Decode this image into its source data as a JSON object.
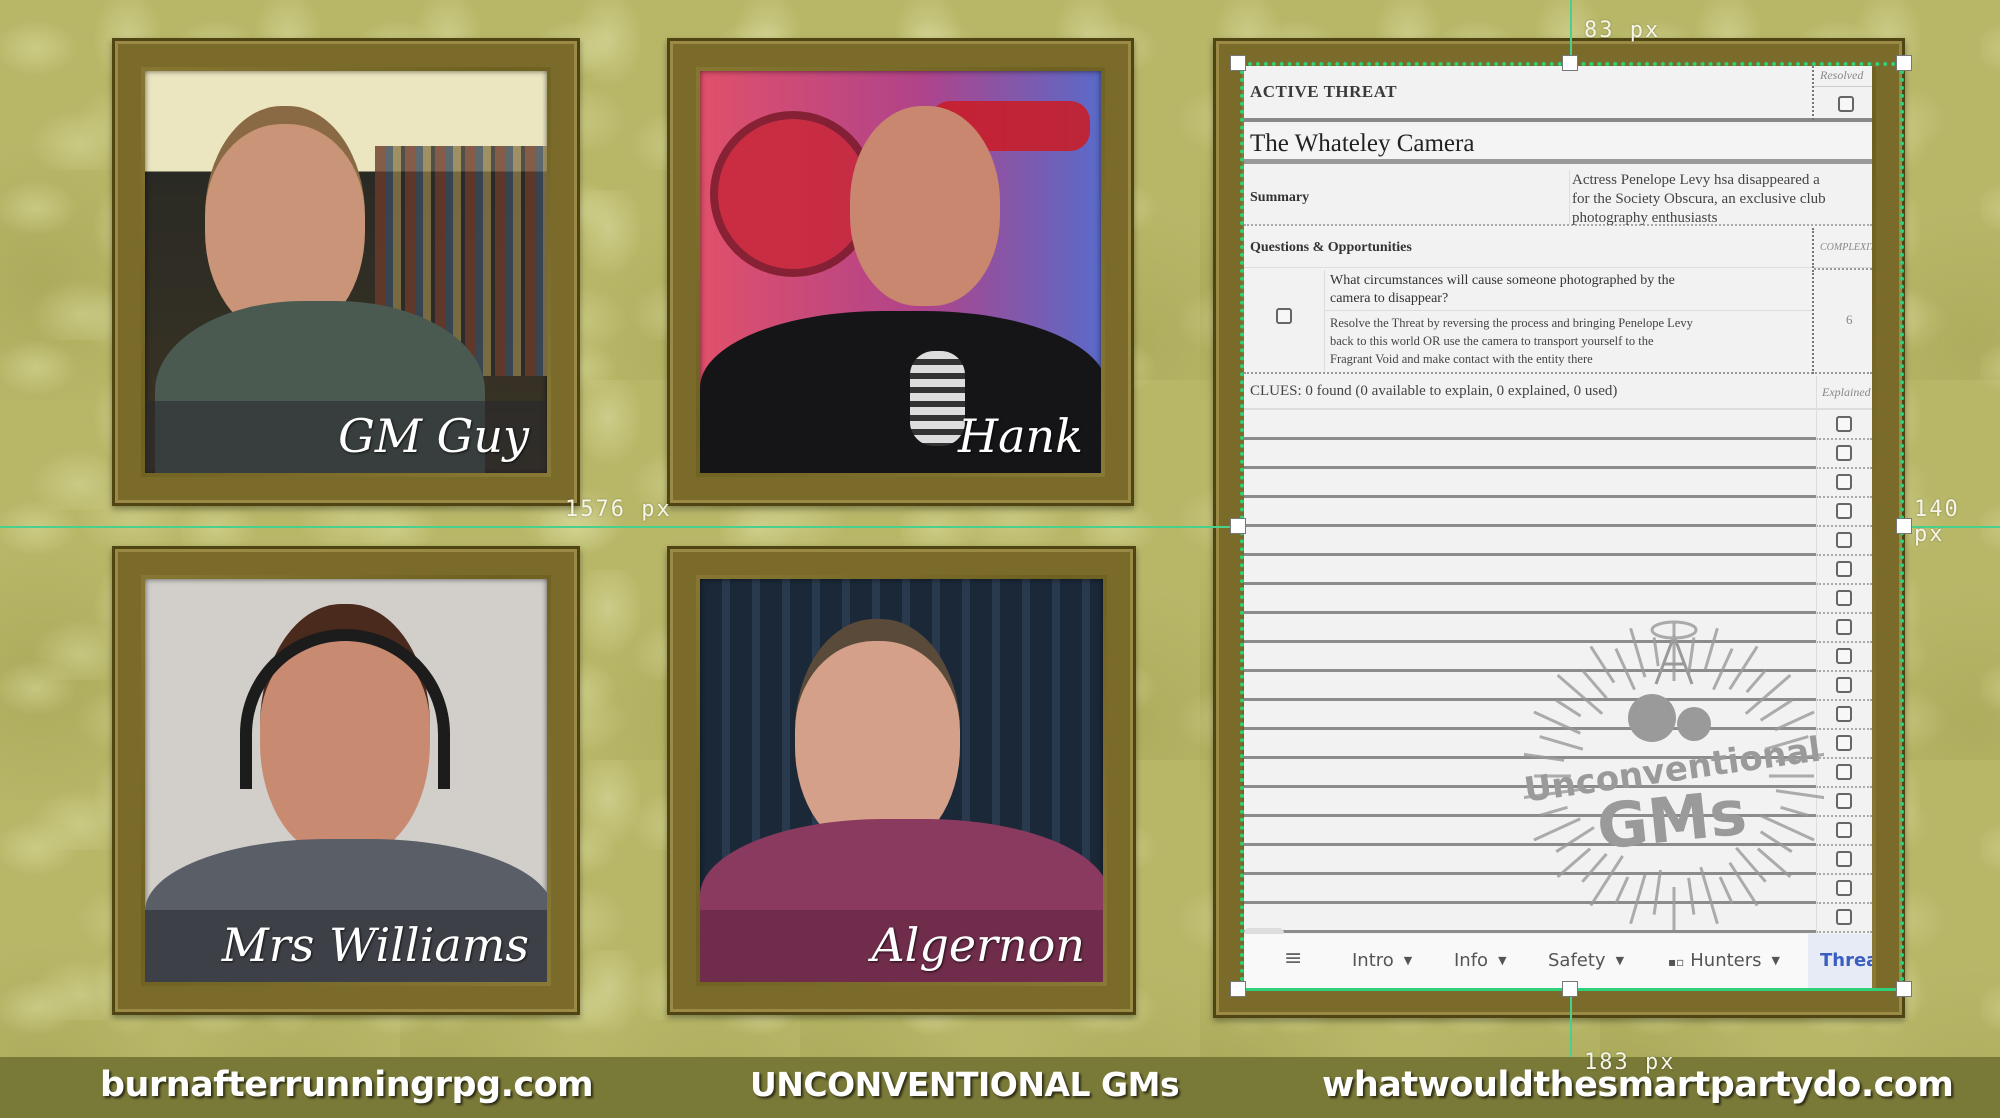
{
  "participants": [
    {
      "name": "GM Guy",
      "bg": "#2f3a2e",
      "wall": "#e9e4bd",
      "skin": "#c99478",
      "hair": "#8a6a44",
      "shirt": "#4a5a50"
    },
    {
      "name": "Hank",
      "bg": "#c23a4a",
      "wall": "#b0438a",
      "skin": "#c8876e",
      "hair": "#7a4a3a",
      "shirt": "#151518"
    },
    {
      "name": "Mrs Williams",
      "bg": "#d9d6d2",
      "wall": "#d2cfca",
      "skin": "#c98a72",
      "hair": "#4a2a1c",
      "shirt": "#5a5e66"
    },
    {
      "name": "Algernon",
      "bg": "#1c2a3a",
      "wall": "#243447",
      "skin": "#d4a08a",
      "hair": "#5a4a3a",
      "shirt": "#8a3a5e"
    }
  ],
  "threat_sheet": {
    "header_label": "ACTIVE THREAT",
    "resolved_label": "Resolved",
    "title": "The Whateley Camera",
    "summary_label": "Summary",
    "summary_lines": [
      "Actress Penelope Levy hsa disappeared a",
      "for the Society Obscura, an exclusive club",
      "photography enthusiasts"
    ],
    "questions_label": "Questions & Opportunities",
    "complexity_label": "COMPLEXITY",
    "question_lines": [
      "What circumstances will cause someone photographed by the",
      "camera to disappear?"
    ],
    "opportunity_lines": [
      "Resolve the Threat by reversing the process and bringing Penelope Levy",
      "back to this world OR use the camera to transport yourself to the",
      "Fragrant Void and make contact with the entity there"
    ],
    "complexity_value": "6",
    "clues_summary": "CLUES: 0 found (0 available to explain, 0 explained, 0 used)",
    "explained_label": "Explained",
    "clue_rows": 18,
    "watermark_top": "Unconventional",
    "watermark_bottom": "GMs"
  },
  "sheet_tabs": {
    "menu_icon": "≡",
    "items": [
      {
        "label": "Intro",
        "has_dropdown": true
      },
      {
        "label": "Info",
        "has_dropdown": true
      },
      {
        "label": "Safety",
        "has_dropdown": true
      },
      {
        "label": "Hunters",
        "has_dropdown": true,
        "icon": "▪▫"
      },
      {
        "label": "Threats",
        "active": true
      }
    ]
  },
  "measurements": {
    "top": "83 px",
    "left": "1576 px",
    "right": "140 px",
    "bottom": "183 px"
  },
  "banner": {
    "left": "burnafterrunningrpg.com",
    "center": "UNCONVENTIONAL GMs",
    "right": "whatwouldthesmartpartydo.com"
  },
  "colors": {
    "selection_guide": "#2fd07a",
    "active_tab_text": "#3b5fc0",
    "active_tab_bg": "#e6ebf5",
    "banner_bg": "#797938"
  }
}
